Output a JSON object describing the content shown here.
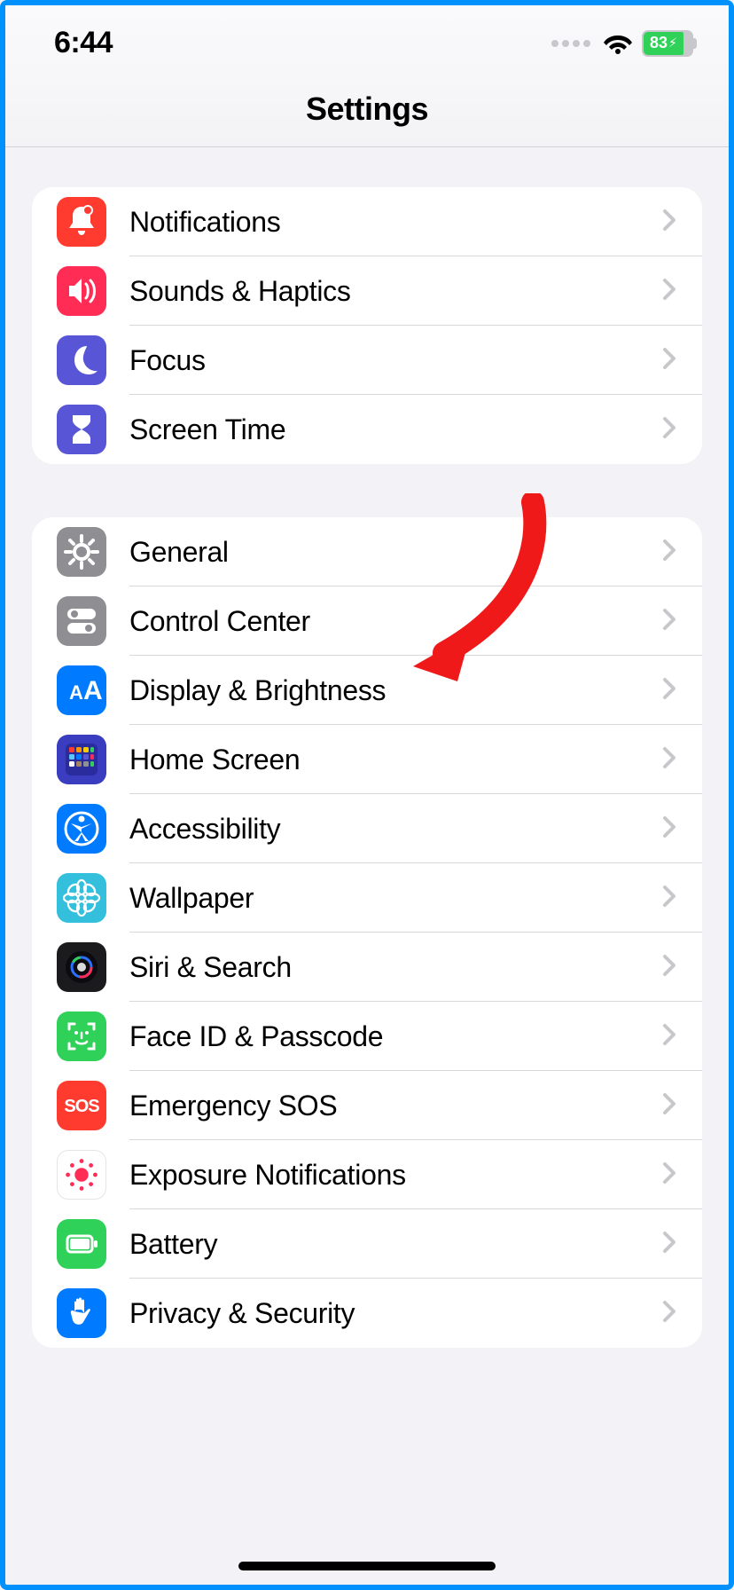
{
  "status": {
    "time": "6:44",
    "battery_percent": "83"
  },
  "header": {
    "title": "Settings"
  },
  "groups": [
    {
      "items": [
        {
          "id": "notifications",
          "label": "Notifications",
          "icon": "bell-icon",
          "bg": "#ff3b30",
          "stroke": "none"
        },
        {
          "id": "sounds-haptics",
          "label": "Sounds & Haptics",
          "icon": "speaker-icon",
          "bg": "#ff2d55",
          "stroke": "none"
        },
        {
          "id": "focus",
          "label": "Focus",
          "icon": "moon-icon",
          "bg": "#5856d6",
          "stroke": "none"
        },
        {
          "id": "screen-time",
          "label": "Screen Time",
          "icon": "hourglass-icon",
          "bg": "#5856d6",
          "stroke": "none"
        }
      ]
    },
    {
      "items": [
        {
          "id": "general",
          "label": "General",
          "icon": "gear-icon",
          "bg": "#8e8e93",
          "stroke": "none"
        },
        {
          "id": "control-center",
          "label": "Control Center",
          "icon": "toggles-icon",
          "bg": "#8e8e93",
          "stroke": "none"
        },
        {
          "id": "display-brightness",
          "label": "Display & Brightness",
          "icon": "textsize-icon",
          "bg": "#007aff",
          "stroke": "none"
        },
        {
          "id": "home-screen",
          "label": "Home Screen",
          "icon": "grid-icon",
          "bg": "#3a3dbf",
          "stroke": "none"
        },
        {
          "id": "accessibility",
          "label": "Accessibility",
          "icon": "accessibility-icon",
          "bg": "#007aff",
          "stroke": "none"
        },
        {
          "id": "wallpaper",
          "label": "Wallpaper",
          "icon": "flower-icon",
          "bg": "#34c0dd",
          "stroke": "none"
        },
        {
          "id": "siri-search",
          "label": "Siri & Search",
          "icon": "siri-icon",
          "bg": "#1b1b1e",
          "stroke": "none"
        },
        {
          "id": "faceid-passcode",
          "label": "Face ID & Passcode",
          "icon": "faceid-icon",
          "bg": "#30d158",
          "stroke": "none"
        },
        {
          "id": "emergency-sos",
          "label": "Emergency SOS",
          "icon": "sos-icon",
          "bg": "#ff3b30",
          "stroke": "none"
        },
        {
          "id": "exposure-notifications",
          "label": "Exposure Notifications",
          "icon": "exposure-icon",
          "bg": "#ffffff",
          "stroke": "#e5e5ea"
        },
        {
          "id": "battery",
          "label": "Battery",
          "icon": "battery-icon",
          "bg": "#30d158",
          "stroke": "none"
        },
        {
          "id": "privacy-security",
          "label": "Privacy & Security",
          "icon": "hand-icon",
          "bg": "#007aff",
          "stroke": "none"
        }
      ]
    }
  ],
  "annotation": {
    "target": "display-brightness"
  }
}
